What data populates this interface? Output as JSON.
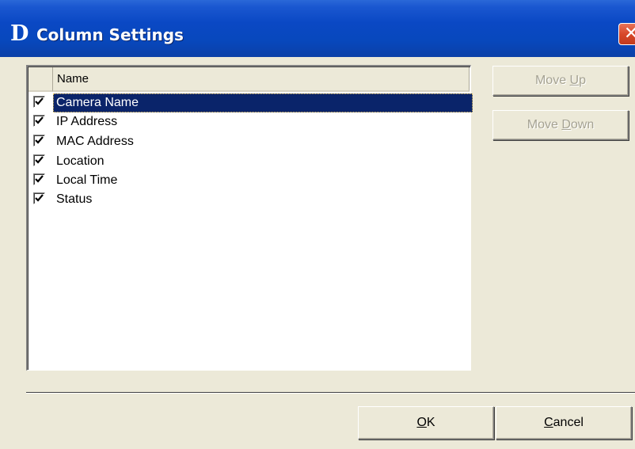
{
  "window": {
    "logo": "D",
    "title": "Column Settings",
    "close_glyph": "✕"
  },
  "list": {
    "column_header": "Name",
    "items": [
      {
        "label": "Camera Name",
        "checked": true,
        "selected": true
      },
      {
        "label": "IP Address",
        "checked": true,
        "selected": false
      },
      {
        "label": "MAC Address",
        "checked": true,
        "selected": false
      },
      {
        "label": "Location",
        "checked": true,
        "selected": false
      },
      {
        "label": "Local Time",
        "checked": true,
        "selected": false
      },
      {
        "label": "Status",
        "checked": true,
        "selected": false
      }
    ]
  },
  "buttons": {
    "move_up": {
      "pre": "Move ",
      "accel": "U",
      "post": "p",
      "enabled": false
    },
    "move_down": {
      "pre": "Move ",
      "accel": "D",
      "post": "own",
      "enabled": false
    },
    "ok": {
      "pre": "",
      "accel": "O",
      "post": "K"
    },
    "cancel": {
      "pre": "",
      "accel": "C",
      "post": "ancel"
    }
  },
  "colors": {
    "titlebar": "#0848bd",
    "selection": "#0a246a",
    "dialog_face": "#ece9d8",
    "close_button": "#d8482a"
  },
  "icons": {
    "checkbox": "check-mark-icon",
    "close": "close-icon"
  }
}
